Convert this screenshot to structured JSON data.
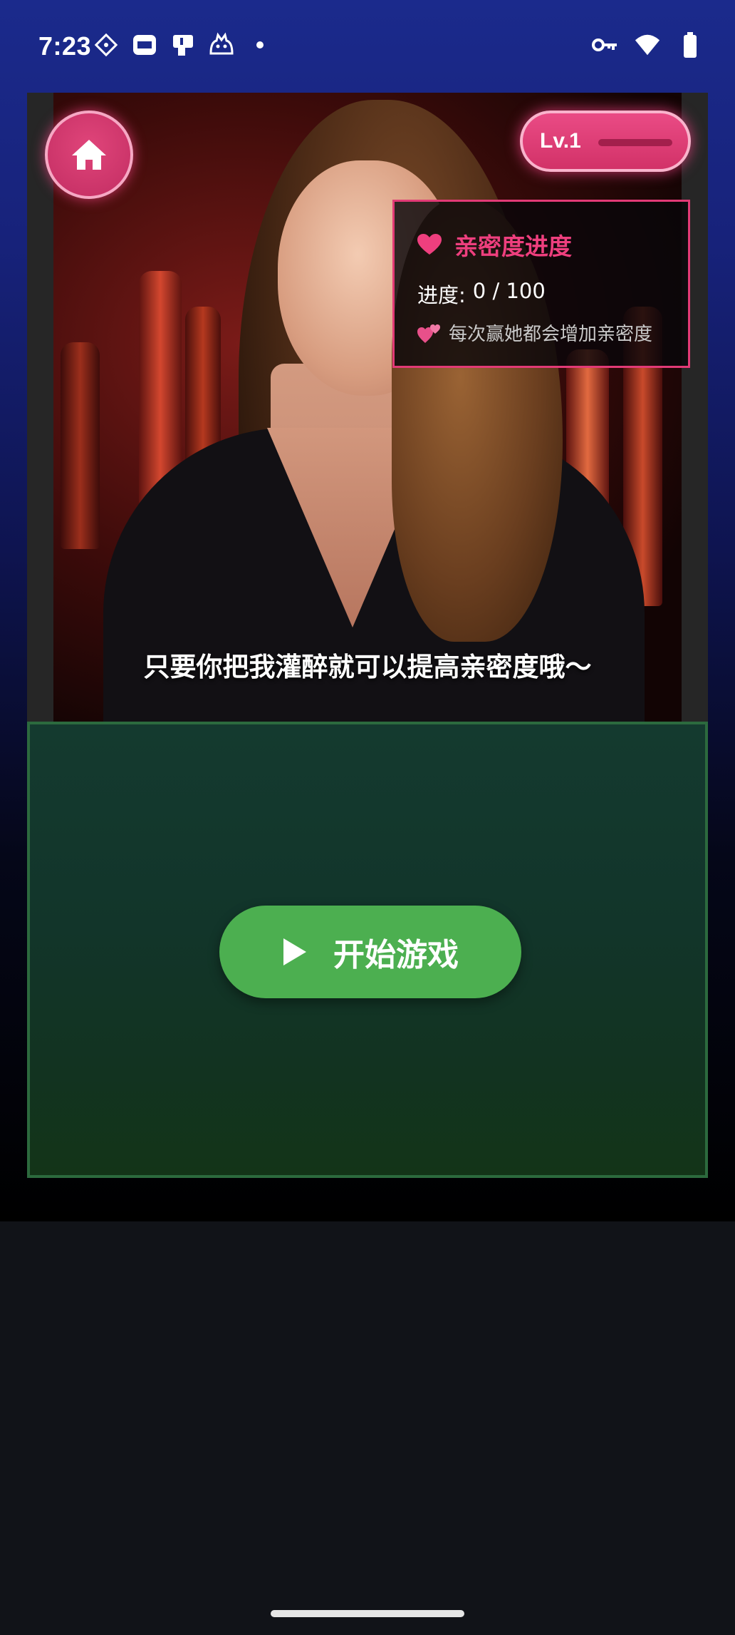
{
  "status_bar": {
    "time": "7:23",
    "left_icons": [
      "grid-diamond-icon",
      "xiaomi-app-icon",
      "card-reader-icon",
      "cat-app-icon",
      "notification-dot-icon"
    ],
    "right_icons": [
      "vpn-key-icon",
      "wifi-icon",
      "battery-icon"
    ]
  },
  "header": {
    "level_label": "Lv.1",
    "level_progress": 0
  },
  "intimacy_card": {
    "title": "亲密度进度",
    "progress_label": "进度:",
    "progress_value": "0 / 100",
    "hint": "每次赢她都会增加亲密度"
  },
  "subtitle": "只要你把我灌醉就可以提高亲密度哦～",
  "game": {
    "start_label": "开始游戏"
  },
  "colors": {
    "accent_pink": "#e23a76",
    "start_green": "#4caf50",
    "game_area_border": "#2c6a3e"
  }
}
